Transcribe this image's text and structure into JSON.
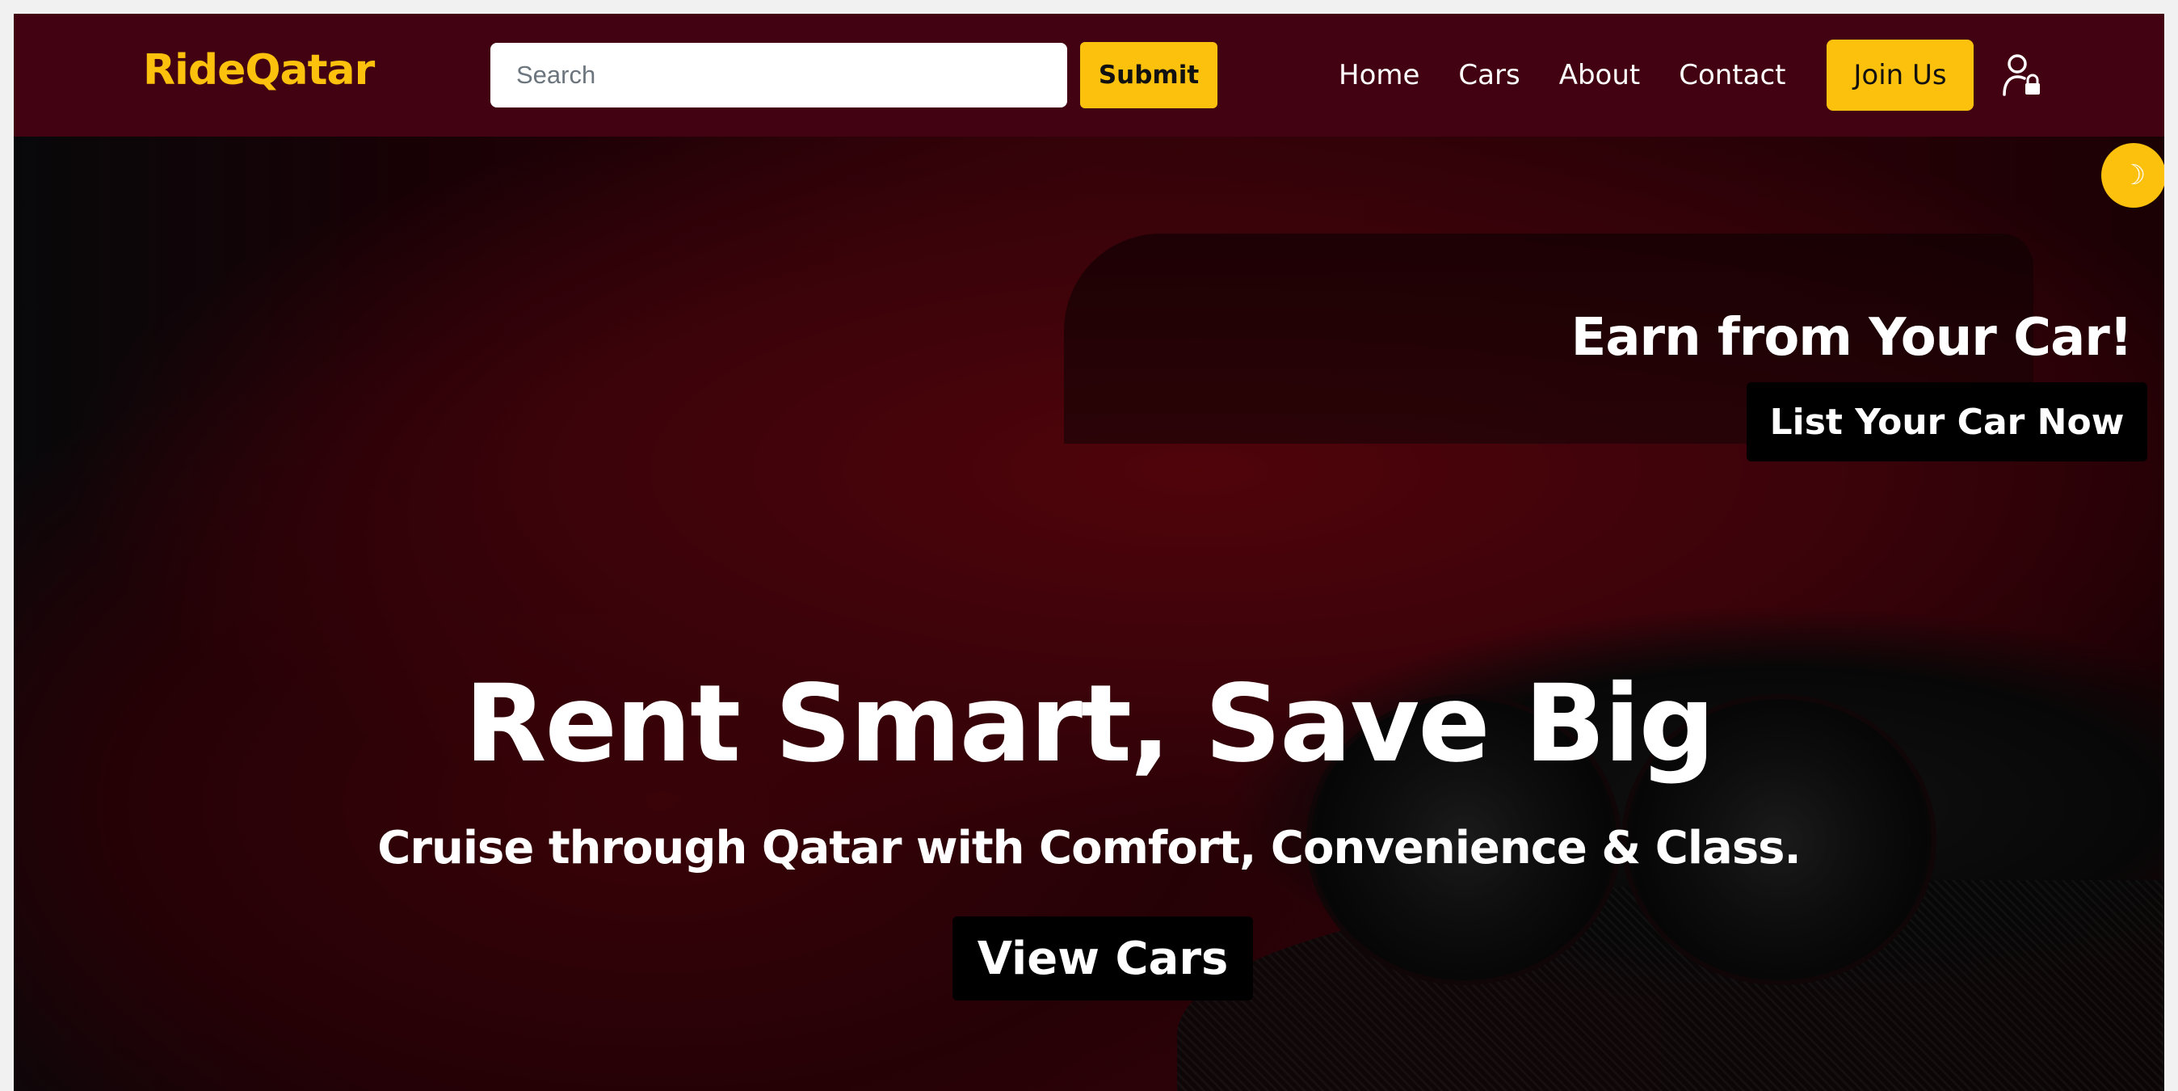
{
  "navbar": {
    "brand": "RideQatar",
    "search": {
      "placeholder": "Search",
      "value": ""
    },
    "submit_label": "Submit",
    "links": [
      "Home",
      "Cars",
      "About",
      "Contact"
    ],
    "join_label": "Join Us",
    "user_icon": "user-lock-icon"
  },
  "hero": {
    "theme_toggle_icon": "moon-icon",
    "theme_toggle_glyph": "☽",
    "earn_title": "Earn from Your Car!",
    "list_car_label": "List Your Car Now",
    "title": "Rent Smart, Save Big",
    "subtitle": "Cruise through Qatar with Comfort, Convenience & Class.",
    "view_cars_label": "View Cars"
  },
  "colors": {
    "navbar_bg": "#420211",
    "accent": "#fcc10d",
    "button_dark": "#000000"
  }
}
